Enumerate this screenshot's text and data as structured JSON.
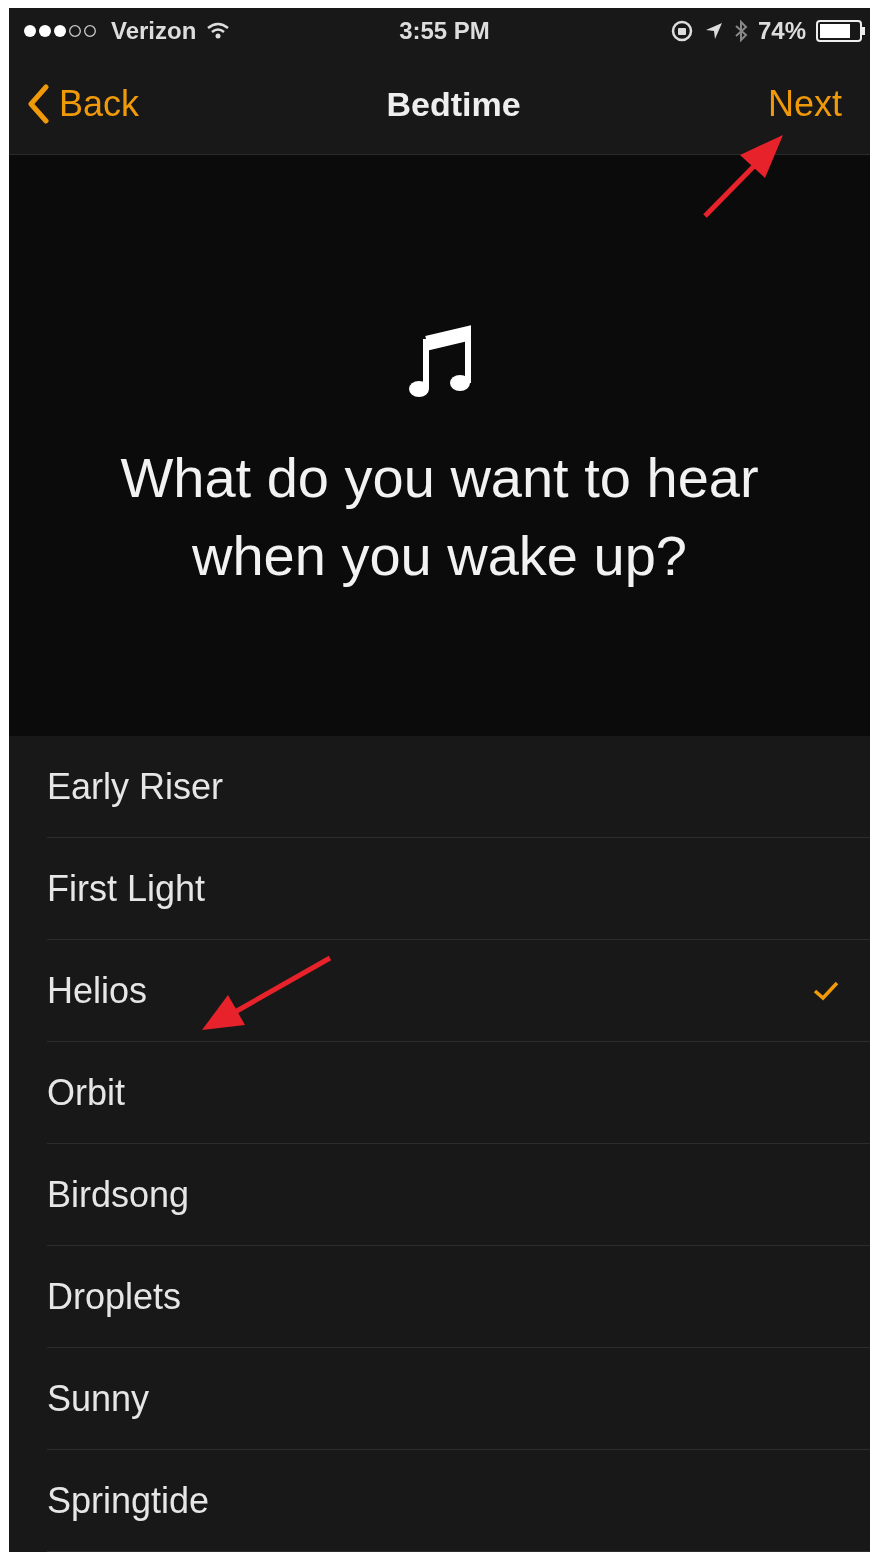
{
  "status_bar": {
    "carrier": "Verizon",
    "time": "3:55 PM",
    "battery": "74%"
  },
  "nav": {
    "back": "Back",
    "title": "Bedtime",
    "next": "Next"
  },
  "prompt": {
    "question": "What do you want to hear when you wake up?"
  },
  "sounds": [
    {
      "label": "Early Riser",
      "selected": false
    },
    {
      "label": "First Light",
      "selected": false
    },
    {
      "label": "Helios",
      "selected": true
    },
    {
      "label": "Orbit",
      "selected": false
    },
    {
      "label": "Birdsong",
      "selected": false
    },
    {
      "label": "Droplets",
      "selected": false
    },
    {
      "label": "Sunny",
      "selected": false
    },
    {
      "label": "Springtide",
      "selected": false
    }
  ]
}
